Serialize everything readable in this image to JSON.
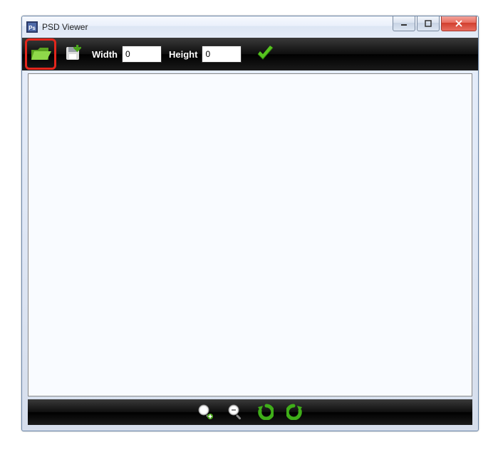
{
  "window": {
    "title": "PSD Viewer"
  },
  "toolbar": {
    "width_label": "Width",
    "height_label": "Height",
    "width_value": "0",
    "height_value": "0"
  }
}
